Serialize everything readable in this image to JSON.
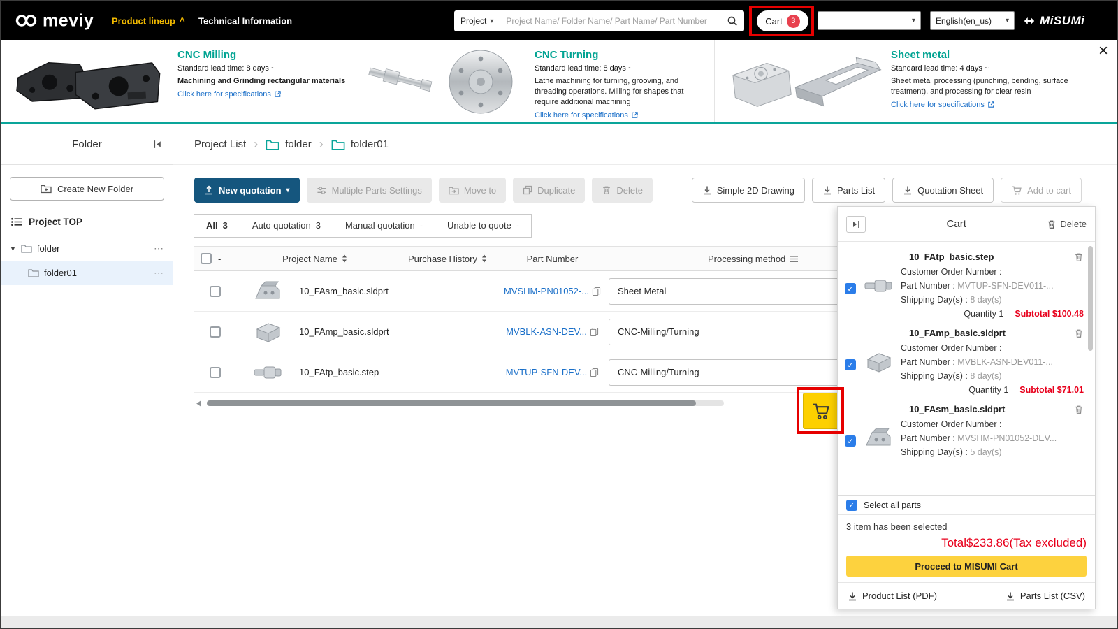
{
  "colors": {
    "accent_teal": "#00a49a",
    "brand_yellow": "#ffd400",
    "alert_red": "#e8001c",
    "annotation_red": "#e60000",
    "link_blue": "#1a6fc8",
    "primary_button_blue": "#15567e",
    "header_black": "#000000"
  },
  "icons": {
    "caret_up": "^",
    "caret_down": "▾",
    "close": "×",
    "more": "⋯",
    "tree_caret": "▼",
    "check": "✓",
    "breadcrumb_separator": "›"
  },
  "header": {
    "logo_text": "meviy",
    "nav": {
      "product_lineup": "Product lineup",
      "technical_information": "Technical Information"
    },
    "search": {
      "category": "Project",
      "placeholder": "Project Name/ Folder Name/ Part Name/ Part Number"
    },
    "cart": {
      "label": "Cart",
      "count": "3"
    },
    "language": "English(en_us)",
    "brand": "MiSUMi"
  },
  "banner": {
    "cards": [
      {
        "title": "CNC Milling",
        "lead_time": "Standard lead time: 8 days ~",
        "description": "Machining and Grinding rectangular materials",
        "link": "Click here for specifications"
      },
      {
        "title": "CNC Turning",
        "lead_time": "Standard lead time: 8 days ~",
        "description": "Lathe machining for turning, grooving, and threading operations. Milling for shapes that require additional machining",
        "link": "Click here for specifications"
      },
      {
        "title": "Sheet metal",
        "lead_time": "Standard lead time: 4 days ~",
        "description": "Sheet metal processing (punching, bending, surface treatment), and processing for clear resin",
        "link": "Click here for specifications"
      }
    ]
  },
  "sidebar": {
    "title": "Folder",
    "create_folder": "Create New Folder",
    "project_top": "Project TOP",
    "folder": "folder",
    "subfolder": "folder01"
  },
  "breadcrumb": {
    "root": "Project List",
    "folder": "folder",
    "subfolder": "folder01"
  },
  "toolbar": {
    "new_quotation": "New quotation",
    "multiple_parts_settings": "Multiple Parts Settings",
    "move_to": "Move to",
    "duplicate": "Duplicate",
    "delete": "Delete",
    "simple_2d_drawing": "Simple 2D Drawing",
    "parts_list": "Parts List",
    "quotation_sheet": "Quotation Sheet",
    "add_to_cart": "Add to cart"
  },
  "tabs": [
    {
      "label": "All",
      "count": "3"
    },
    {
      "label": "Auto quotation",
      "count": "3"
    },
    {
      "label": "Manual quotation",
      "count": "-"
    },
    {
      "label": "Unable to quote",
      "count": "-"
    }
  ],
  "table": {
    "headers": {
      "dash": "-",
      "project_name": "Project Name",
      "purchase_history": "Purchase History",
      "part_number": "Part Number",
      "processing_method": "Processing method"
    },
    "rows": [
      {
        "project_name": "10_FAsm_basic.sldprt",
        "part_number": "MVSHM-PN01052-...",
        "processing_method": "Sheet Metal"
      },
      {
        "project_name": "10_FAmp_basic.sldprt",
        "part_number": "MVBLK-ASN-DEV...",
        "processing_method": "CNC-Milling/Turning"
      },
      {
        "project_name": "10_FAtp_basic.step",
        "part_number": "MVTUP-SFN-DEV...",
        "processing_method": "CNC-Milling/Turning"
      }
    ]
  },
  "cart_panel": {
    "title": "Cart",
    "delete": "Delete",
    "labels": {
      "customer_order": "Customer Order Number :",
      "part_number": "Part Number :",
      "shipping": "Shipping Day(s) :",
      "quantity": "Quantity",
      "subtotal": "Subtotal"
    },
    "items": [
      {
        "name": "10_FAtp_basic.step",
        "part_number": "MVTUP-SFN-DEV011-...",
        "shipping": "8 day(s)",
        "quantity": "1",
        "subtotal": "$100.48"
      },
      {
        "name": "10_FAmp_basic.sldprt",
        "part_number": "MVBLK-ASN-DEV011-...",
        "shipping": "8 day(s)",
        "quantity": "1",
        "subtotal": "$71.01"
      },
      {
        "name": "10_FAsm_basic.sldprt",
        "part_number": "MVSHM-PN01052-DEV...",
        "shipping": "5 day(s)"
      }
    ],
    "select_all": "Select all parts",
    "selected_info": "3 item has been selected",
    "total": "Total$233.86(Tax excluded)",
    "proceed": "Proceed to MISUMI Cart",
    "product_list_pdf": "Product List (PDF)",
    "parts_list_csv": "Parts List (CSV)"
  }
}
